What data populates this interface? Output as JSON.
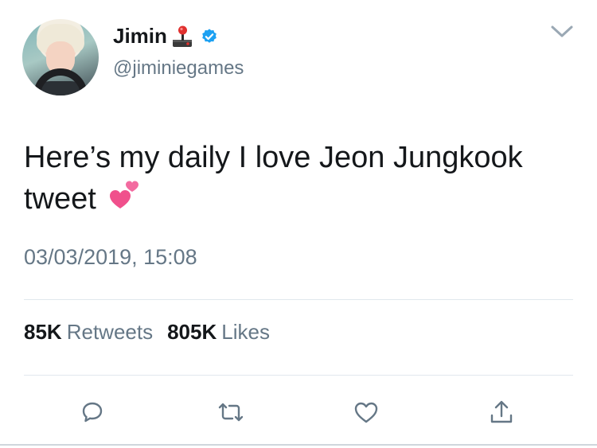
{
  "user": {
    "display_name": "Jimin",
    "handle": "@jiminiegames",
    "name_emoji": "joystick-icon",
    "verified": true
  },
  "tweet": {
    "text": "Here’s my daily I love Jeon Jungkook tweet",
    "emoji": "two-hearts-icon",
    "timestamp": "03/03/2019, 15:08"
  },
  "stats": {
    "retweets_count": "85K",
    "retweets_label": "Retweets",
    "likes_count": "805K",
    "likes_label": "Likes"
  },
  "actions": [
    "reply-icon",
    "retweet-icon",
    "like-icon",
    "share-icon"
  ],
  "colors": {
    "text_primary": "#14171a",
    "text_secondary": "#657786",
    "verified_blue": "#1da1f2",
    "divider": "#e1e8ed",
    "heart_pink": "#f0508c"
  }
}
